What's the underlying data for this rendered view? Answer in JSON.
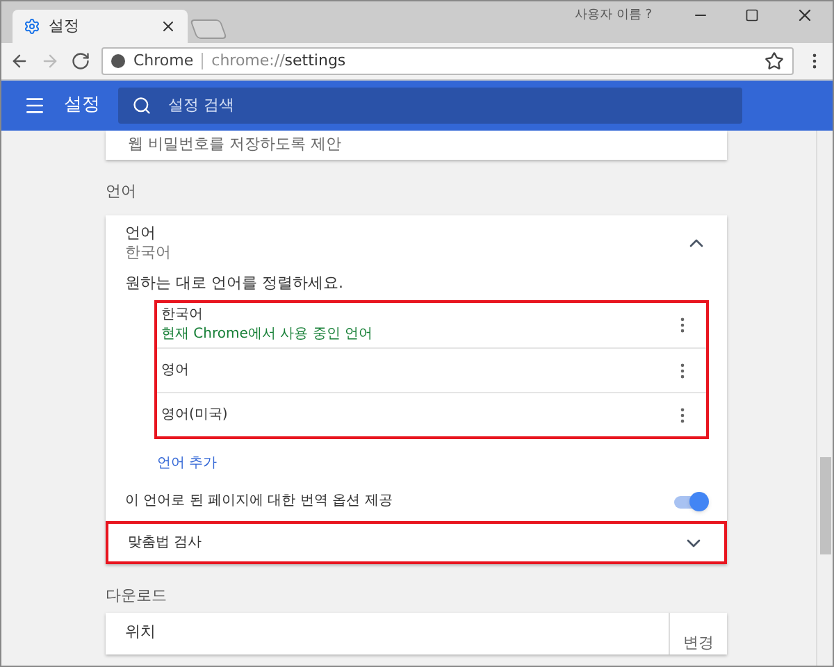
{
  "tab": {
    "title": "설정"
  },
  "profile": {
    "name": "사용자 이름 ?"
  },
  "address": {
    "site": "Chrome",
    "url_prefix": "chrome://",
    "url_path": "settings"
  },
  "header": {
    "title": "설정",
    "search_placeholder": "설정 검색"
  },
  "prev_card": {
    "text": "웹 비밀번호를 저장하도록 제안"
  },
  "language_section": {
    "heading": "언어",
    "title": "언어",
    "value": "한국어",
    "expanded": true,
    "instruction": "원하는 대로 언어를 정렬하세요.",
    "languages": [
      {
        "name": "한국어",
        "note": "현재 Chrome에서 사용 중인 언어"
      },
      {
        "name": "영어"
      },
      {
        "name": "영어(미국)"
      }
    ],
    "add_link": "언어 추가",
    "translate": {
      "label": "이 언어로 된 페이지에 대한 번역 옵션 제공",
      "on": true
    },
    "spellcheck": {
      "label": "맞춤법 검사",
      "expanded": false
    }
  },
  "download_section": {
    "heading": "다운로드",
    "location_label": "위치",
    "change_button": "변경"
  }
}
